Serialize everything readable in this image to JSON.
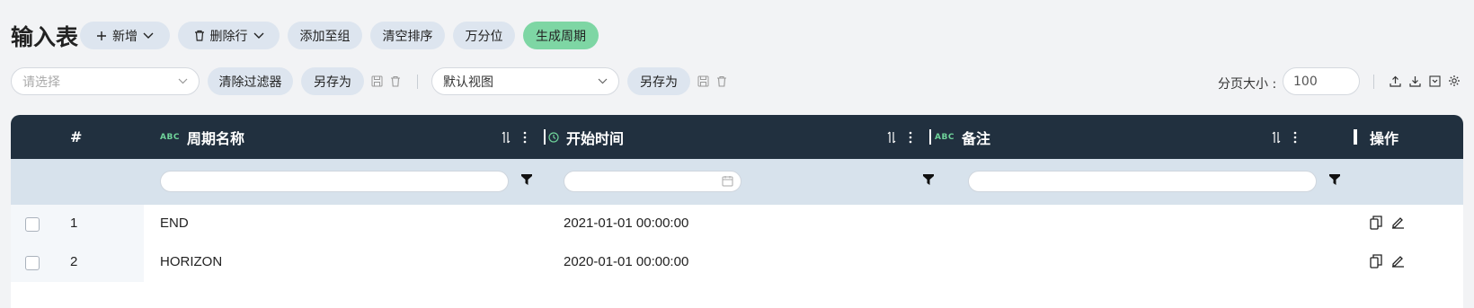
{
  "page_title": "输入表",
  "toolbar": {
    "add_label": "新增",
    "delete_row_label": "删除行",
    "add_to_group_label": "添加至组",
    "clear_sort_label": "清空排序",
    "percentile_label": "万分位",
    "generate_period_label": "生成周期"
  },
  "filterbar": {
    "filter_select_placeholder": "请选择",
    "clear_filter_label": "清除过滤器",
    "save_as_label": "另存为",
    "view_select_value": "默认视图",
    "view_save_as_label": "另存为",
    "page_size_label": "分页大小 :",
    "page_size_value": "100"
  },
  "table": {
    "columns": {
      "index": "#",
      "period_name": "周期名称",
      "start_time": "开始时间",
      "remark": "备注",
      "actions": "操作"
    },
    "type_tag": "ABC",
    "rows": [
      {
        "index": "1",
        "period_name": "END",
        "start_time": "2021-01-01 00:00:00",
        "remark": ""
      },
      {
        "index": "2",
        "period_name": "HORIZON",
        "start_time": "2020-01-01 00:00:00",
        "remark": ""
      }
    ]
  },
  "colors": {
    "header_bg": "#21303f",
    "filter_row_bg": "#d7e2ec",
    "button_bg": "#dde5ef",
    "accent_green": "#7ed6a4"
  }
}
